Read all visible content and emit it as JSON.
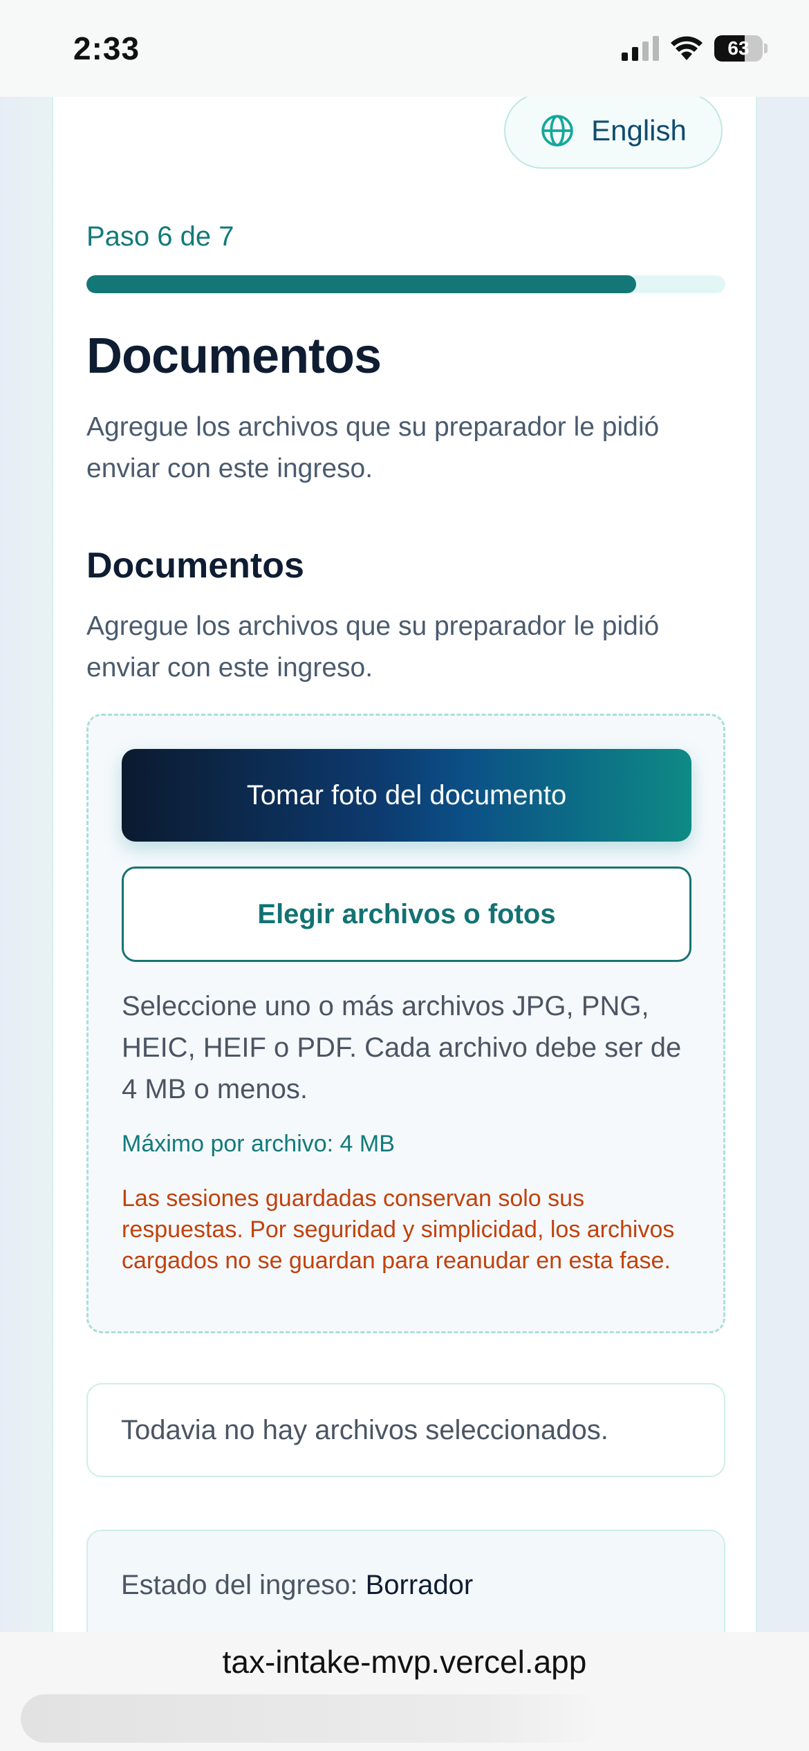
{
  "status_bar": {
    "time": "2:33",
    "battery": "63"
  },
  "language_button": {
    "label": "English",
    "icon": "globe-icon"
  },
  "progress": {
    "label": "Paso 6 de 7",
    "fraction": 0.86
  },
  "heading": "Documentos",
  "intro": "Agregue los archivos que su preparador le pidió enviar con este ingreso.",
  "section": {
    "title": "Documentos",
    "description": "Agregue los archivos que su preparador le pidió enviar con este ingreso."
  },
  "upload": {
    "camera_button": "Tomar foto del documento",
    "files_button": "Elegir archivos o fotos",
    "help": "Seleccione uno o más archivos JPG, PNG, HEIC, HEIF o PDF. Cada archivo debe ser de 4 MB o menos.",
    "max_size": "Máximo por archivo: 4 MB",
    "warning": "Las sesiones guardadas conservan solo sus respuestas. Por seguridad y simplicidad, los archivos cargados no se guardan para reanudar en esta fase."
  },
  "files": {
    "empty_text": "Todavia no hay archivos seleccionados."
  },
  "intake_status": {
    "label": "Estado del ingreso:",
    "value": "Borrador"
  },
  "browser": {
    "url": "tax-intake-mvp.vercel.app"
  },
  "colors": {
    "accent": "#137777",
    "warning": "#c2410c",
    "heading": "#0f1d33"
  }
}
